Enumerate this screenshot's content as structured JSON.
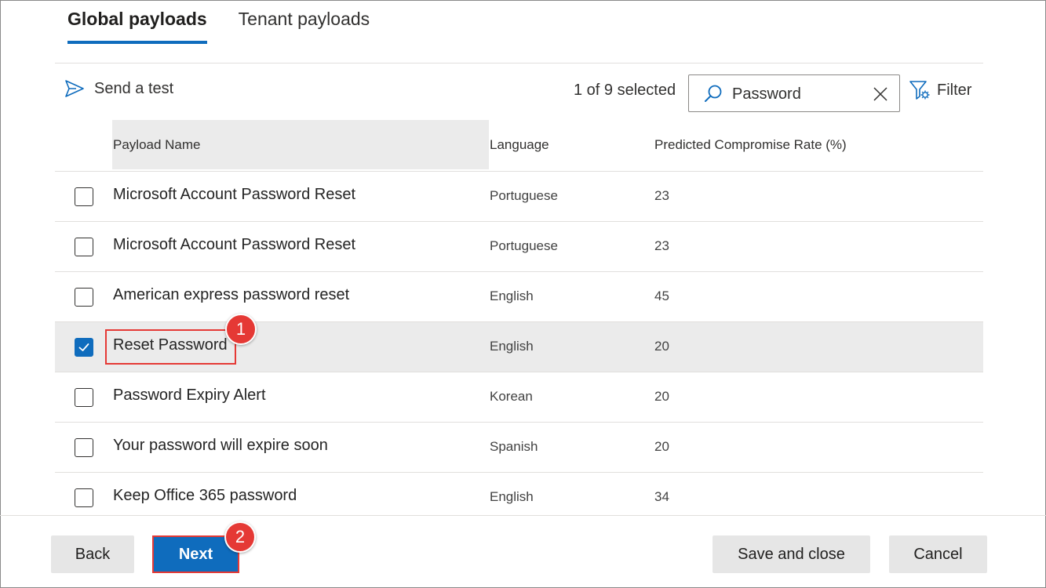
{
  "tabs": [
    {
      "label": "Global payloads",
      "active": true
    },
    {
      "label": "Tenant payloads",
      "active": false
    }
  ],
  "toolbar": {
    "send_test_label": "Send a test",
    "selected_count": "1 of 9 selected",
    "search_value": "Password",
    "filter_label": "Filter"
  },
  "table": {
    "headers": {
      "name": "Payload Name",
      "language": "Language",
      "rate": "Predicted Compromise Rate (%)"
    },
    "rows": [
      {
        "name": "Microsoft Account Password Reset",
        "language": "Portuguese",
        "rate": "23",
        "checked": false
      },
      {
        "name": "Microsoft Account Password Reset",
        "language": "Portuguese",
        "rate": "23",
        "checked": false
      },
      {
        "name": "American express password reset",
        "language": "English",
        "rate": "45",
        "checked": false
      },
      {
        "name": "Reset Password",
        "language": "English",
        "rate": "20",
        "checked": true
      },
      {
        "name": "Password Expiry Alert",
        "language": "Korean",
        "rate": "20",
        "checked": false
      },
      {
        "name": "Your password will expire soon",
        "language": "Spanish",
        "rate": "20",
        "checked": false
      },
      {
        "name": "Keep Office 365 password",
        "language": "English",
        "rate": "34",
        "checked": false
      }
    ]
  },
  "annotations": {
    "step1": "1",
    "step2": "2"
  },
  "footer": {
    "back_label": "Back",
    "next_label": "Next",
    "save_close_label": "Save and close",
    "cancel_label": "Cancel"
  },
  "colors": {
    "accent": "#0f6cbd",
    "annotation_red": "#e53935",
    "selected_row_bg": "#ebebeb"
  }
}
